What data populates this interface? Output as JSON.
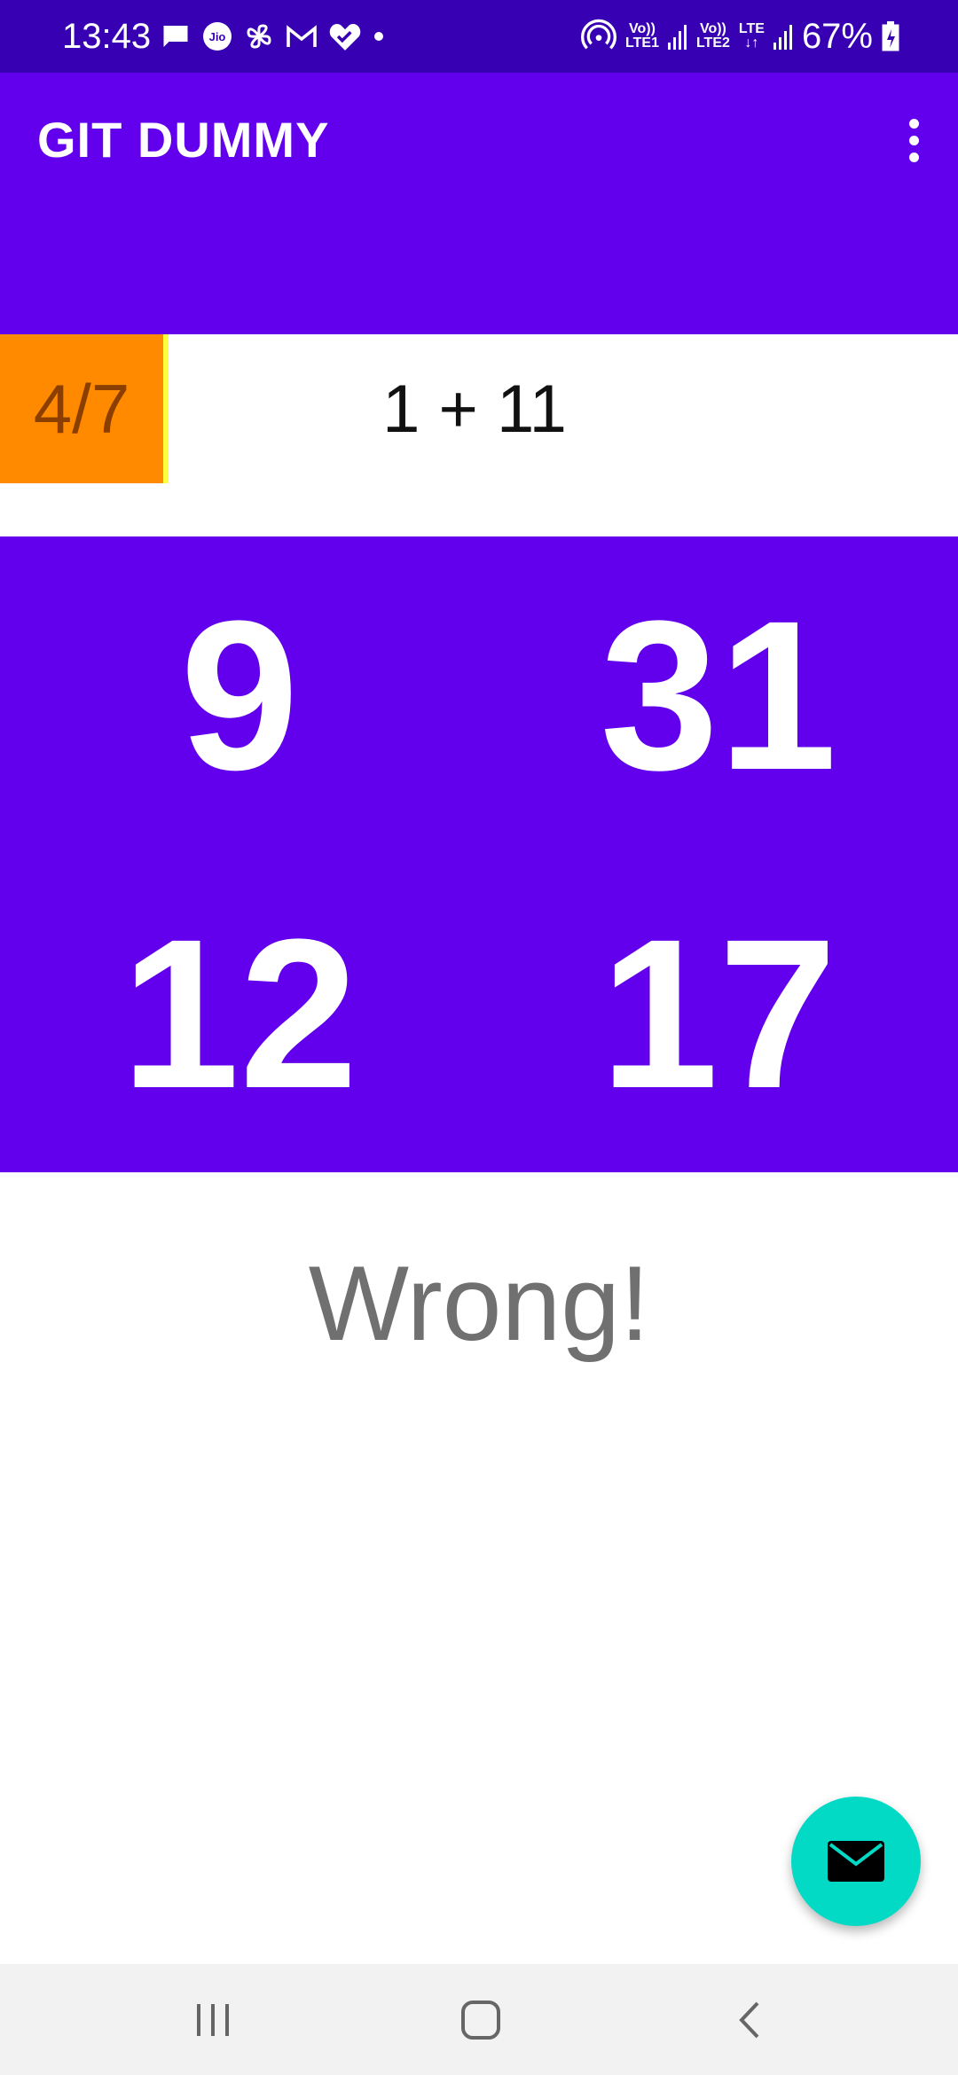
{
  "status_bar": {
    "time": "13:43",
    "battery": "67%",
    "net1": [
      "Vo))",
      "LTE1"
    ],
    "net2": [
      "Vo))",
      "LTE2"
    ],
    "lte": "LTE",
    "jio": "Jio",
    "icons": [
      "message-icon",
      "jio-icon",
      "pinwheel-icon",
      "gmail-icon",
      "health-icon",
      "dot-icon",
      "hotspot-icon",
      "signal-icon",
      "battery-icon"
    ]
  },
  "app_bar": {
    "title": "GIT DUMMY"
  },
  "question": {
    "score": "4/7",
    "expression": "1 + 11"
  },
  "answers": [
    "9",
    "31",
    "12",
    "17"
  ],
  "result": "Wrong!",
  "colors": {
    "status_bar": "#3700b3",
    "primary": "#6200ee",
    "score_bg": "#ff8a00",
    "fab": "#03dac5"
  }
}
